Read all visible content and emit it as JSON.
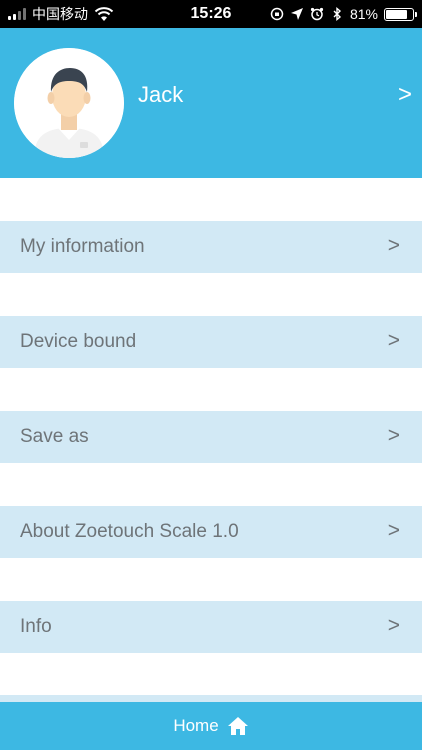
{
  "status_bar": {
    "carrier": "中国移动",
    "time": "15:26",
    "battery_percent": "81%",
    "battery_level": 0.81
  },
  "header": {
    "user_name": "Jack",
    "chevron": ">"
  },
  "menu": {
    "items": [
      {
        "label": "My information",
        "chevron": ">"
      },
      {
        "label": "Device bound",
        "chevron": ">"
      },
      {
        "label": "Save as",
        "chevron": ">"
      },
      {
        "label": "About Zoetouch Scale 1.0",
        "chevron": ">"
      },
      {
        "label": "Info",
        "chevron": ">"
      }
    ]
  },
  "footer": {
    "home_label": "Home"
  },
  "colors": {
    "primary": "#3db8e3",
    "menu_row": "#d2e9f5",
    "menu_text": "#6e7478"
  }
}
